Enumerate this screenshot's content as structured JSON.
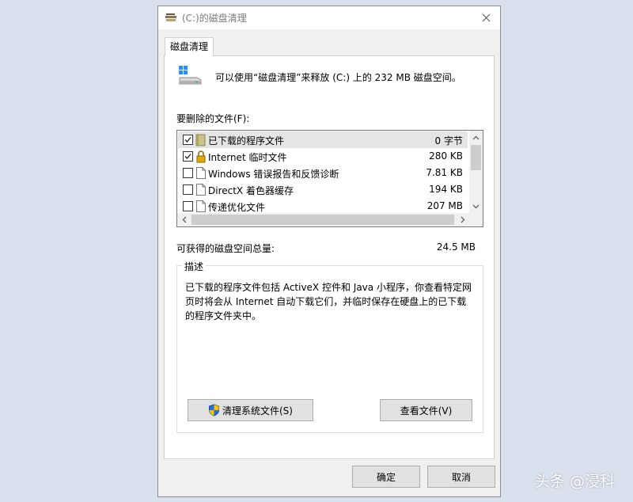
{
  "window": {
    "title": "(C:)的磁盘清理"
  },
  "tabs": [
    {
      "label": "磁盘清理",
      "active": true
    }
  ],
  "intro": {
    "text": "可以使用“磁盘清理”来释放  (C:) 上的 232 MB 磁盘空间。"
  },
  "files": {
    "label": "要删除的文件(F):",
    "items": [
      {
        "name": "已下载的程序文件",
        "size": "0 字节",
        "checked": true,
        "icon": "folder-icon",
        "selected": true
      },
      {
        "name": "Internet 临时文件",
        "size": "280 KB",
        "checked": true,
        "icon": "lock-icon",
        "selected": false
      },
      {
        "name": "Windows 错误报告和反馈诊断",
        "size": "7.81 KB",
        "checked": false,
        "icon": "file-icon",
        "selected": false
      },
      {
        "name": "DirectX 着色器缓存",
        "size": "194 KB",
        "checked": false,
        "icon": "file-icon",
        "selected": false
      },
      {
        "name": "传递优化文件",
        "size": "207 MB",
        "checked": false,
        "icon": "file-icon",
        "selected": false
      }
    ]
  },
  "total": {
    "label": "可获得的磁盘空间总量:",
    "value": "24.5 MB"
  },
  "description": {
    "title": "描述",
    "text": "已下载的程序文件包括 ActiveX 控件和 Java 小程序，你查看特定网页时将会从 Internet 自动下载它们，并临时保存在硬盘上的已下载的程序文件夹中。"
  },
  "buttons": {
    "cleanup_system": "清理系统文件(S)",
    "view_files": "查看文件(V)",
    "ok": "确定",
    "cancel": "取消"
  },
  "watermark": "头条 @浸科",
  "colors": {
    "background": "#d9e1ee",
    "window": "#f0f0f0",
    "button": "#e1e1e1",
    "selected_row": "#e5e5e5"
  }
}
